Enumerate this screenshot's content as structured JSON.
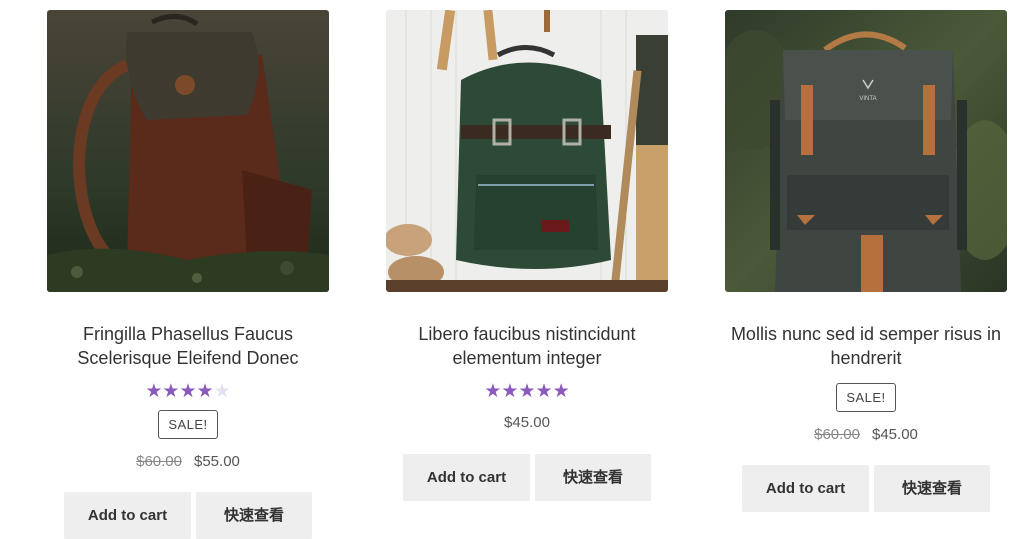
{
  "products": [
    {
      "title": "Fringilla Phasellus Faucus Scelerisque Eleifend Donec",
      "rating": 4,
      "sale_badge": "SALE!",
      "old_price": "$60.00",
      "price": "$55.00",
      "add_to_cart": "Add to cart",
      "quick_view": "快速查看"
    },
    {
      "title": "Libero faucibus nistincidunt elementum integer",
      "rating": 5,
      "price": "$45.00",
      "add_to_cart": "Add to cart",
      "quick_view": "快速查看"
    },
    {
      "title": "Mollis nunc sed id semper risus in hendrerit",
      "sale_badge": "SALE!",
      "old_price": "$60.00",
      "price": "$45.00",
      "add_to_cart": "Add to cart",
      "quick_view": "快速查看"
    }
  ],
  "colors": {
    "star": "#8a5bbd",
    "button_bg": "#eeeeee"
  },
  "image_brand_text": "VINTA"
}
